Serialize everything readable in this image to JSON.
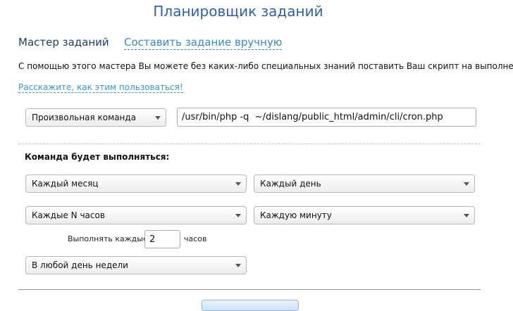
{
  "page": {
    "title": "Планировщик заданий"
  },
  "tabs": {
    "wizard": "Мастер заданий",
    "manual": "Составить задание вручную"
  },
  "intro_text": "С помощью этого мастера Вы можете без каких-либо специальных знаний поставить Ваш скрипт на выполнение.",
  "help_link": "Расскажите, как этим пользоваться!",
  "command": {
    "type_selected": "Произвольная команда",
    "path_value": "/usr/bin/php -q  ~/dislang/public_html/admin/cli/cron.php"
  },
  "schedule": {
    "section_label": "Команда будет выполняться:",
    "month_selected": "Каждый месяц",
    "day_selected": "Каждый день",
    "hours_selected": "Каждые N часов",
    "minute_selected": "Каждую минуту",
    "every_label": "Выполнять каждые",
    "every_value": "2",
    "every_unit": "часов",
    "weekday_selected": "В любой день недели"
  },
  "icons": {
    "dropdown": "chevron-down-icon"
  }
}
